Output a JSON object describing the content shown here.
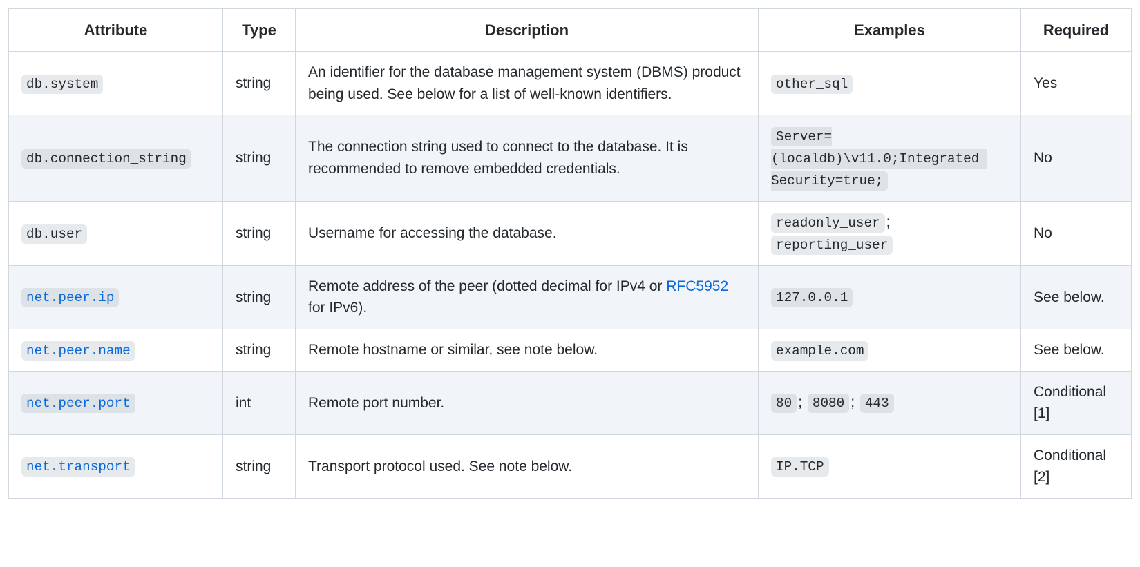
{
  "headers": {
    "attribute": "Attribute",
    "type": "Type",
    "description": "Description",
    "examples": "Examples",
    "required": "Required"
  },
  "rows": [
    {
      "attr": "db.system",
      "attr_link": false,
      "type": "string",
      "desc_parts": [
        {
          "kind": "text",
          "value": "An identifier for the database management system (DBMS) product being used. See below for a list of well-known identifiers."
        }
      ],
      "examples": [
        {
          "kind": "code",
          "value": "other_sql"
        }
      ],
      "required": "Yes"
    },
    {
      "attr": "db.connection_string",
      "attr_link": false,
      "type": "string",
      "desc_parts": [
        {
          "kind": "text",
          "value": "The connection string used to connect to the database. It is recommended to remove embedded credentials."
        }
      ],
      "examples": [
        {
          "kind": "code",
          "value": "Server=(localdb)\\v11.0;Integrated Security=true;"
        }
      ],
      "required": "No"
    },
    {
      "attr": "db.user",
      "attr_link": false,
      "type": "string",
      "desc_parts": [
        {
          "kind": "text",
          "value": "Username for accessing the database."
        }
      ],
      "examples": [
        {
          "kind": "code",
          "value": "readonly_user"
        },
        {
          "kind": "sep",
          "value": "; "
        },
        {
          "kind": "code",
          "value": "reporting_user"
        }
      ],
      "required": "No"
    },
    {
      "attr": "net.peer.ip",
      "attr_link": true,
      "type": "string",
      "desc_parts": [
        {
          "kind": "text",
          "value": "Remote address of the peer (dotted decimal for IPv4 or "
        },
        {
          "kind": "link",
          "value": "RFC5952"
        },
        {
          "kind": "text",
          "value": " for IPv6)."
        }
      ],
      "examples": [
        {
          "kind": "code",
          "value": "127.0.0.1"
        }
      ],
      "required": "See below."
    },
    {
      "attr": "net.peer.name",
      "attr_link": true,
      "type": "string",
      "desc_parts": [
        {
          "kind": "text",
          "value": "Remote hostname or similar, see note below."
        }
      ],
      "examples": [
        {
          "kind": "code",
          "value": "example.com"
        }
      ],
      "required": "See below."
    },
    {
      "attr": "net.peer.port",
      "attr_link": true,
      "type": "int",
      "desc_parts": [
        {
          "kind": "text",
          "value": "Remote port number."
        }
      ],
      "examples": [
        {
          "kind": "code",
          "value": "80"
        },
        {
          "kind": "sep",
          "value": "; "
        },
        {
          "kind": "code",
          "value": "8080"
        },
        {
          "kind": "sep",
          "value": "; "
        },
        {
          "kind": "code",
          "value": "443"
        }
      ],
      "required": "Conditional [1]"
    },
    {
      "attr": "net.transport",
      "attr_link": true,
      "type": "string",
      "desc_parts": [
        {
          "kind": "text",
          "value": "Transport protocol used. See note below."
        }
      ],
      "examples": [
        {
          "kind": "code",
          "value": "IP.TCP"
        }
      ],
      "required": "Conditional [2]"
    }
  ]
}
